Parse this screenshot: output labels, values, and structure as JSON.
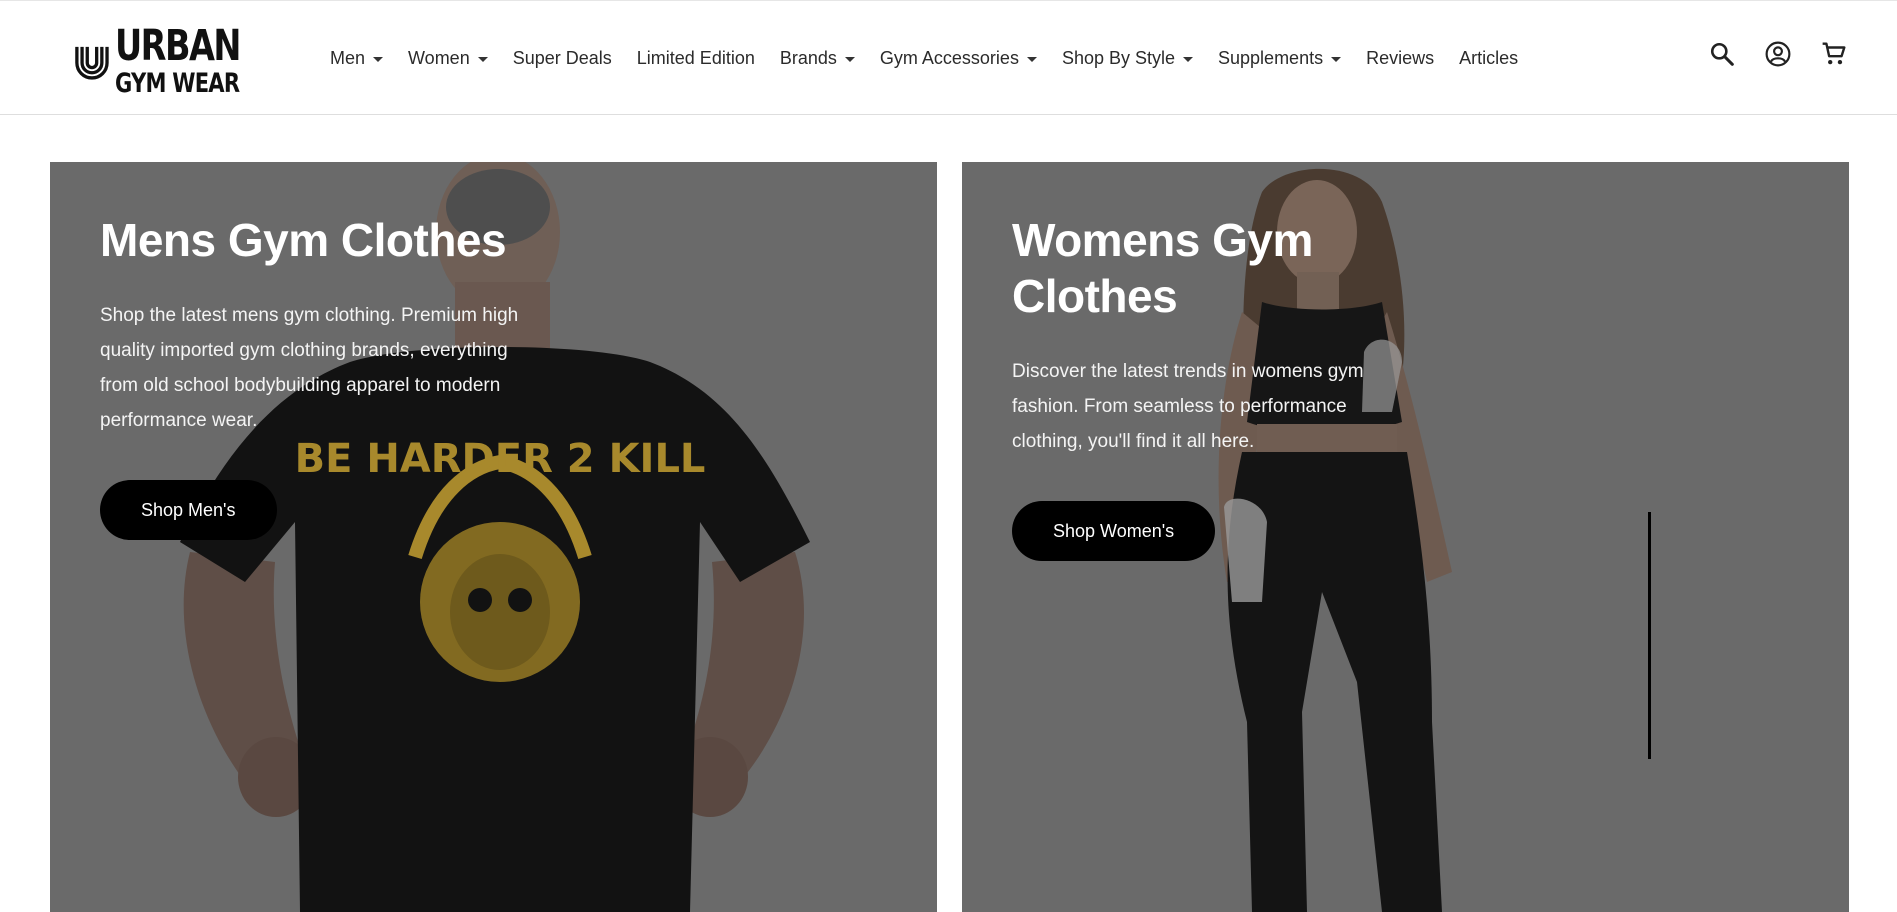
{
  "brand": {
    "logo_word1": "URBAN",
    "logo_word2": "GYM WEAR"
  },
  "nav": {
    "items": [
      {
        "label": "Men",
        "dropdown": true
      },
      {
        "label": "Women",
        "dropdown": true
      },
      {
        "label": "Super Deals",
        "dropdown": false
      },
      {
        "label": "Limited Edition",
        "dropdown": false
      },
      {
        "label": "Brands",
        "dropdown": true
      },
      {
        "label": "Gym Accessories",
        "dropdown": true
      },
      {
        "label": "Shop By Style",
        "dropdown": true
      },
      {
        "label": "Supplements",
        "dropdown": true
      },
      {
        "label": "Reviews",
        "dropdown": false
      },
      {
        "label": "Articles",
        "dropdown": false
      }
    ]
  },
  "header_icons": [
    "search-icon",
    "account-icon",
    "cart-icon"
  ],
  "men": {
    "title": "Mens Gym Clothes",
    "text": "Shop the latest mens gym clothing. Premium high quality imported gym clothing brands, everything from old school bodybuilding apparel to modern performance wear.",
    "button": "Shop Men's",
    "shirt_print": "BE HARDER 2 KILL"
  },
  "women": {
    "title": "Womens Gym Clothes",
    "text": "Discover the latest trends in womens gym fashion. From seamless to performance clothing, you'll find it all here.",
    "button": "Shop Women's"
  },
  "colors": {
    "overlay": "#6a6a6a",
    "button_bg": "#000000",
    "button_text": "#ffffff",
    "print_gold": "#b8962a"
  }
}
